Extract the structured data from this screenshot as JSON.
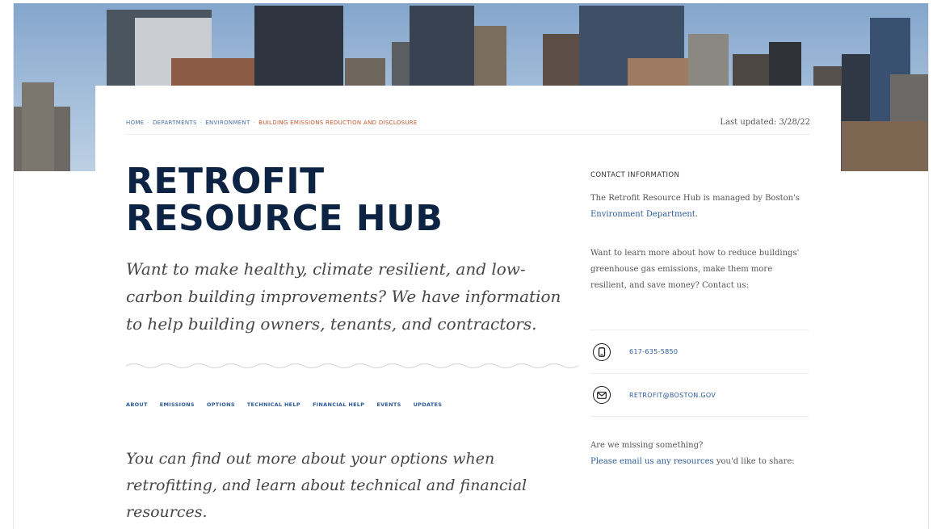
{
  "breadcrumb": {
    "items": [
      "HOME",
      "DEPARTMENTS",
      "ENVIRONMENT",
      "BUILDING EMISSIONS REDUCTION AND DISCLOSURE"
    ]
  },
  "last_updated": "Last updated: 3/28/22",
  "page": {
    "title_line1": "RETROFIT",
    "title_line2": "RESOURCE HUB",
    "lede": "Want to make healthy, climate resilient, and low-carbon building improvements? We have information to help building owners, tenants, and contractors.",
    "intro": "You can find out more about your options when retrofitting, and learn about technical and financial resources."
  },
  "tabs": [
    "ABOUT",
    "EMISSIONS",
    "OPTIONS",
    "TECHNICAL HELP",
    "FINANCIAL HELP",
    "EVENTS",
    "UPDATES"
  ],
  "sidebar": {
    "heading": "CONTACT INFORMATION",
    "managed_prefix": "The Retrofit Resource Hub is managed by Boston's ",
    "managed_link": "Environment Department",
    "managed_suffix": ".",
    "learn_more": "Want to learn more about how to reduce buildings' greenhouse gas emissions, make them more resilient, and save money? Contact us:",
    "phone": "617-635-5850",
    "email": "RETROFIT@BOSTON.GOV",
    "missing": "Are we missing something?",
    "email_link": "Please email us any resources",
    "missing_suffix": " you'd like to share:"
  },
  "icons": {
    "phone": "phone-icon",
    "email": "email-icon"
  },
  "colors": {
    "title": "#0c2343",
    "link": "#2d5b99",
    "breadcrumb_current": "#c2562d"
  }
}
